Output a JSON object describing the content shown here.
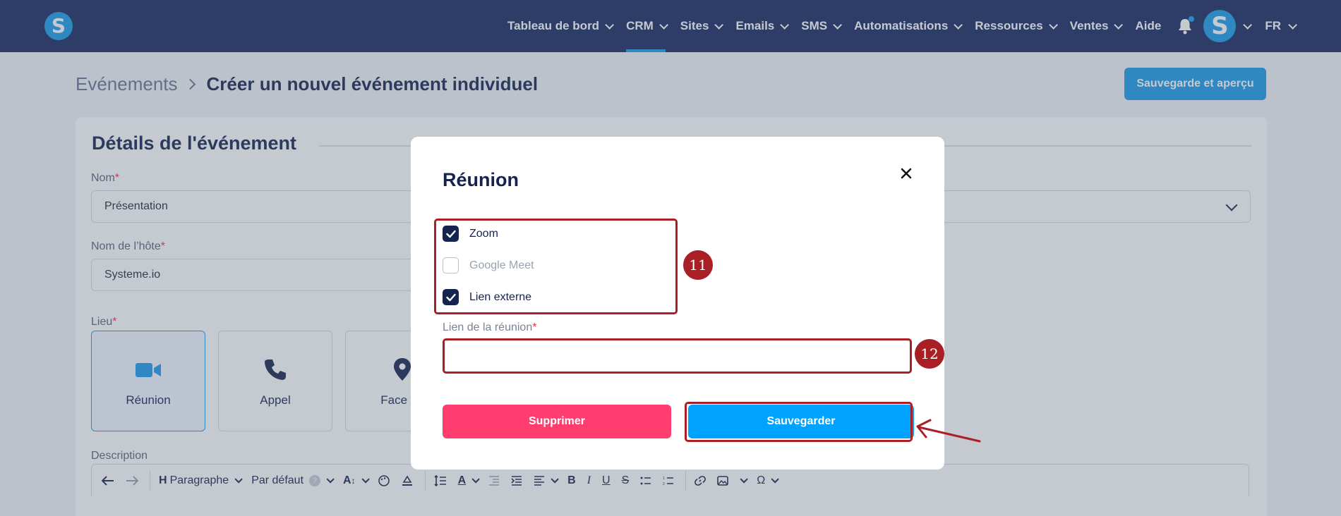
{
  "topnav": {
    "logo": "S",
    "items": [
      {
        "label": "Tableau de bord",
        "chevron": true
      },
      {
        "label": "CRM",
        "chevron": true,
        "active": true
      },
      {
        "label": "Sites",
        "chevron": true
      },
      {
        "label": "Emails",
        "chevron": true
      },
      {
        "label": "SMS",
        "chevron": true
      },
      {
        "label": "Automatisations",
        "chevron": true
      },
      {
        "label": "Ressources",
        "chevron": true
      },
      {
        "label": "Ventes",
        "chevron": true
      },
      {
        "label": "Aide",
        "chevron": false
      }
    ],
    "avatar": "S",
    "language": "FR"
  },
  "page": {
    "breadcrumb_parent": "Evénements",
    "title": "Créer un nouvel événement individuel",
    "preview_button": "Sauvegarde et aperçu"
  },
  "event_details": {
    "title": "Détails de l'événement",
    "name_label": "Nom",
    "name_value": "Présentation",
    "host_label": "Nom de l’hôte",
    "host_value": "Systeme.io",
    "location_label": "Lieu",
    "locations": [
      {
        "label": "Réunion",
        "icon": "video-camera-icon",
        "active": true
      },
      {
        "label": "Appel",
        "icon": "phone-icon",
        "active": false
      },
      {
        "label": "Face à f",
        "icon": "map-pin-icon",
        "active": false
      }
    ],
    "description_label": "Description",
    "toolbar": {
      "paragraph": "Paragraphe",
      "font": "Par défaut",
      "help": "?"
    }
  },
  "modal": {
    "title": "Réunion",
    "options": [
      {
        "label": "Zoom",
        "checked": true
      },
      {
        "label": "Google Meet",
        "checked": false
      },
      {
        "label": "Lien externe",
        "checked": true
      }
    ],
    "link_label": "Lien de la réunion",
    "link_value": "",
    "delete_button": "Supprimer",
    "save_button": "Sauvegarder"
  },
  "annotations": {
    "step_options": "11",
    "step_link": "12"
  },
  "colors": {
    "nav_bg": "#16295e",
    "brand_blue": "#1a9be8",
    "save_blue": "#00a2ff",
    "delete_pink": "#ff3d6e",
    "annotation_red": "#a82025"
  }
}
